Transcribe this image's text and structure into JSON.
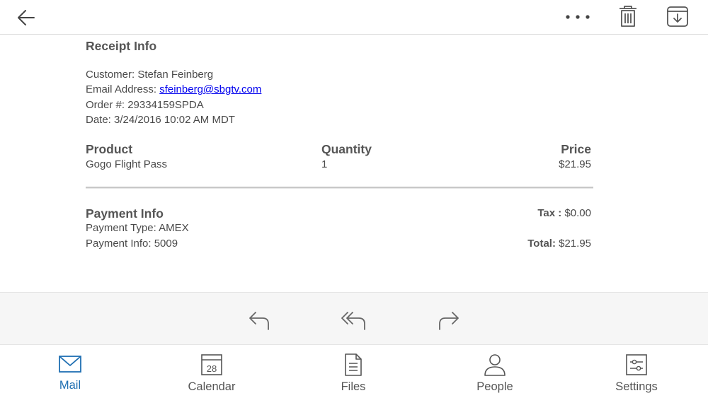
{
  "colors": {
    "accent": "#1f6fb2",
    "text": "#4a4a4a",
    "link": "#0000ee",
    "icon": "#555555"
  },
  "toolbar": {
    "back_icon": "arrow-left-icon",
    "more_icon": "more-horizontal-icon",
    "delete_icon": "trash-icon",
    "archive_icon": "archive-download-icon"
  },
  "receipt": {
    "heading": "Receipt Info",
    "customer_label": "Customer: ",
    "customer": "Stefan Feinberg",
    "email_label": "Email Address: ",
    "email": "sfeinberg@sbgtv.com",
    "order_label": "Order #: ",
    "order": "29334159SPDA",
    "date_label": "Date: ",
    "date": "3/24/2016 10:02 AM MDT"
  },
  "items": {
    "headers": {
      "product": "Product",
      "quantity": "Quantity",
      "price": "Price"
    },
    "rows": [
      {
        "product": "Gogo Flight Pass",
        "quantity": "1",
        "price": "$21.95"
      }
    ]
  },
  "payment": {
    "heading": "Payment Info",
    "type_label": "Payment Type: ",
    "type": "AMEX",
    "info_label": "Payment Info: ",
    "info": "5009",
    "tax_label": "Tax :",
    "tax": " $0.00",
    "total_label": "Total:",
    "total": " $21.95"
  },
  "actions": {
    "reply_icon": "reply-icon",
    "reply_all_icon": "reply-all-icon",
    "forward_icon": "forward-icon"
  },
  "tabs": [
    {
      "label": "Mail",
      "icon": "mail-icon",
      "active": true
    },
    {
      "label": "Calendar",
      "icon": "calendar-icon",
      "date": "28"
    },
    {
      "label": "Files",
      "icon": "file-icon"
    },
    {
      "label": "People",
      "icon": "person-icon"
    },
    {
      "label": "Settings",
      "icon": "settings-sliders-icon"
    }
  ]
}
